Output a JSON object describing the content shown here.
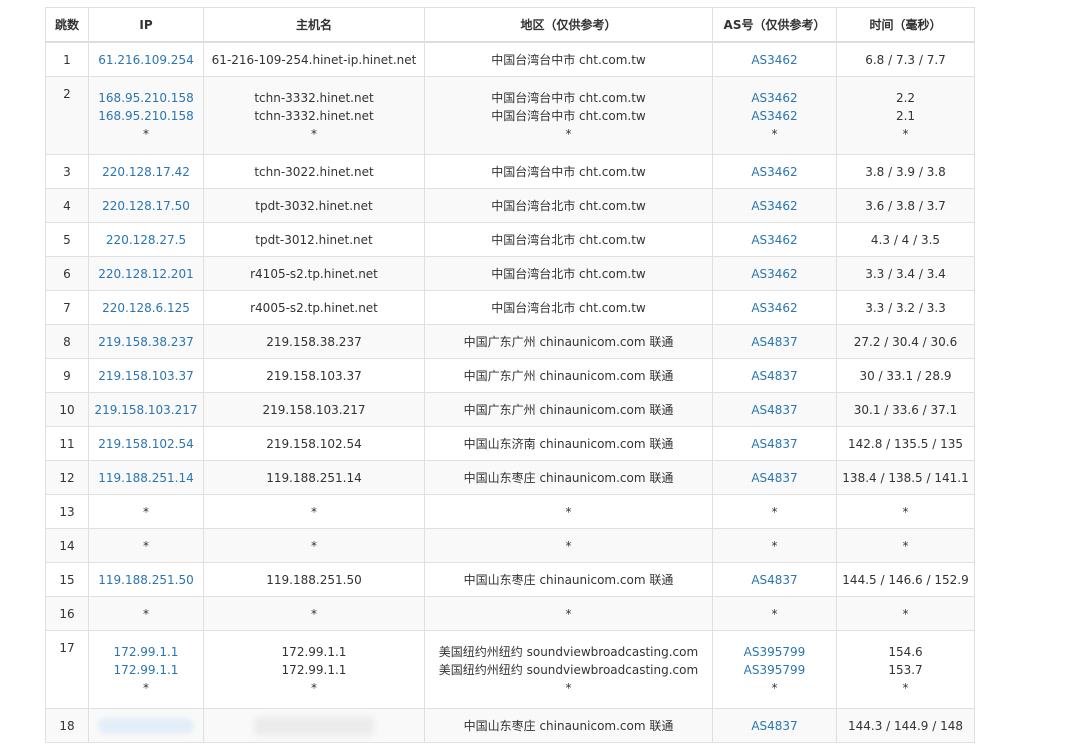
{
  "table": {
    "headers": {
      "hop": "跳数",
      "ip": "IP",
      "host": "主机名",
      "region": "地区（仅供参考）",
      "as": "AS号（仅供参考）",
      "time": "时间（毫秒）"
    },
    "rows": [
      {
        "hop": "1",
        "ip": [
          "61.216.109.254"
        ],
        "host": [
          "61-216-109-254.hinet-ip.hinet.net"
        ],
        "region": [
          "中国台湾台中市 cht.com.tw"
        ],
        "as": [
          "AS3462"
        ],
        "time": [
          "6.8 / 7.3 / 7.7"
        ]
      },
      {
        "hop": "2",
        "ip": [
          "168.95.210.158",
          "168.95.210.158",
          "*"
        ],
        "host": [
          "tchn-3332.hinet.net",
          "tchn-3332.hinet.net",
          "*"
        ],
        "region": [
          "中国台湾台中市 cht.com.tw",
          "中国台湾台中市 cht.com.tw",
          "*"
        ],
        "as": [
          "AS3462",
          "AS3462",
          "*"
        ],
        "time": [
          "2.2",
          "2.1",
          "*"
        ]
      },
      {
        "hop": "3",
        "ip": [
          "220.128.17.42"
        ],
        "host": [
          "tchn-3022.hinet.net"
        ],
        "region": [
          "中国台湾台中市 cht.com.tw"
        ],
        "as": [
          "AS3462"
        ],
        "time": [
          "3.8 / 3.9 / 3.8"
        ]
      },
      {
        "hop": "4",
        "ip": [
          "220.128.17.50"
        ],
        "host": [
          "tpdt-3032.hinet.net"
        ],
        "region": [
          "中国台湾台北市 cht.com.tw"
        ],
        "as": [
          "AS3462"
        ],
        "time": [
          "3.6 / 3.8 / 3.7"
        ]
      },
      {
        "hop": "5",
        "ip": [
          "220.128.27.5"
        ],
        "host": [
          "tpdt-3012.hinet.net"
        ],
        "region": [
          "中国台湾台北市 cht.com.tw"
        ],
        "as": [
          "AS3462"
        ],
        "time": [
          "4.3 / 4 / 3.5"
        ]
      },
      {
        "hop": "6",
        "ip": [
          "220.128.12.201"
        ],
        "host": [
          "r4105-s2.tp.hinet.net"
        ],
        "region": [
          "中国台湾台北市 cht.com.tw"
        ],
        "as": [
          "AS3462"
        ],
        "time": [
          "3.3 / 3.4 / 3.4"
        ]
      },
      {
        "hop": "7",
        "ip": [
          "220.128.6.125"
        ],
        "host": [
          "r4005-s2.tp.hinet.net"
        ],
        "region": [
          "中国台湾台北市 cht.com.tw"
        ],
        "as": [
          "AS3462"
        ],
        "time": [
          "3.3 / 3.2 / 3.3"
        ]
      },
      {
        "hop": "8",
        "ip": [
          "219.158.38.237"
        ],
        "host": [
          "219.158.38.237"
        ],
        "region": [
          "中国广东广州 chinaunicom.com 联通"
        ],
        "as": [
          "AS4837"
        ],
        "time": [
          "27.2 / 30.4 / 30.6"
        ]
      },
      {
        "hop": "9",
        "ip": [
          "219.158.103.37"
        ],
        "host": [
          "219.158.103.37"
        ],
        "region": [
          "中国广东广州 chinaunicom.com 联通"
        ],
        "as": [
          "AS4837"
        ],
        "time": [
          "30 / 33.1 / 28.9"
        ]
      },
      {
        "hop": "10",
        "ip": [
          "219.158.103.217"
        ],
        "host": [
          "219.158.103.217"
        ],
        "region": [
          "中国广东广州 chinaunicom.com 联通"
        ],
        "as": [
          "AS4837"
        ],
        "time": [
          "30.1 / 33.6 / 37.1"
        ]
      },
      {
        "hop": "11",
        "ip": [
          "219.158.102.54"
        ],
        "host": [
          "219.158.102.54"
        ],
        "region": [
          "中国山东济南 chinaunicom.com 联通"
        ],
        "as": [
          "AS4837"
        ],
        "time": [
          "142.8 / 135.5 / 135"
        ]
      },
      {
        "hop": "12",
        "ip": [
          "119.188.251.14"
        ],
        "host": [
          "119.188.251.14"
        ],
        "region": [
          "中国山东枣庄 chinaunicom.com 联通"
        ],
        "as": [
          "AS4837"
        ],
        "time": [
          "138.4 / 138.5 / 141.1"
        ]
      },
      {
        "hop": "13",
        "ip": [
          "*"
        ],
        "host": [
          "*"
        ],
        "region": [
          "*"
        ],
        "as": [
          "*"
        ],
        "time": [
          "*"
        ]
      },
      {
        "hop": "14",
        "ip": [
          "*"
        ],
        "host": [
          "*"
        ],
        "region": [
          "*"
        ],
        "as": [
          "*"
        ],
        "time": [
          "*"
        ]
      },
      {
        "hop": "15",
        "ip": [
          "119.188.251.50"
        ],
        "host": [
          "119.188.251.50"
        ],
        "region": [
          "中国山东枣庄 chinaunicom.com 联通"
        ],
        "as": [
          "AS4837"
        ],
        "time": [
          "144.5 / 146.6 / 152.9"
        ]
      },
      {
        "hop": "16",
        "ip": [
          "*"
        ],
        "host": [
          "*"
        ],
        "region": [
          "*"
        ],
        "as": [
          "*"
        ],
        "time": [
          "*"
        ]
      },
      {
        "hop": "17",
        "ip": [
          "172.99.1.1",
          "172.99.1.1",
          "*"
        ],
        "host": [
          "172.99.1.1",
          "172.99.1.1",
          "*"
        ],
        "region": [
          "美国纽约州纽约 soundviewbroadcasting.com",
          "美国纽约州纽约 soundviewbroadcasting.com",
          "*"
        ],
        "as": [
          "AS395799",
          "AS395799",
          "*"
        ],
        "time": [
          "154.6",
          "153.7",
          "*"
        ]
      },
      {
        "hop": "18",
        "ip": [],
        "host": [],
        "region": [
          "中国山东枣庄 chinaunicom.com 联通"
        ],
        "as": [
          "AS4837"
        ],
        "time": [
          "144.3 / 144.9 / 148"
        ],
        "redacted": true
      }
    ]
  },
  "colors": {
    "link": "#2a75b3",
    "text": "#333333",
    "border": "#e0e0e0",
    "zebra": "#f9f9f9"
  }
}
